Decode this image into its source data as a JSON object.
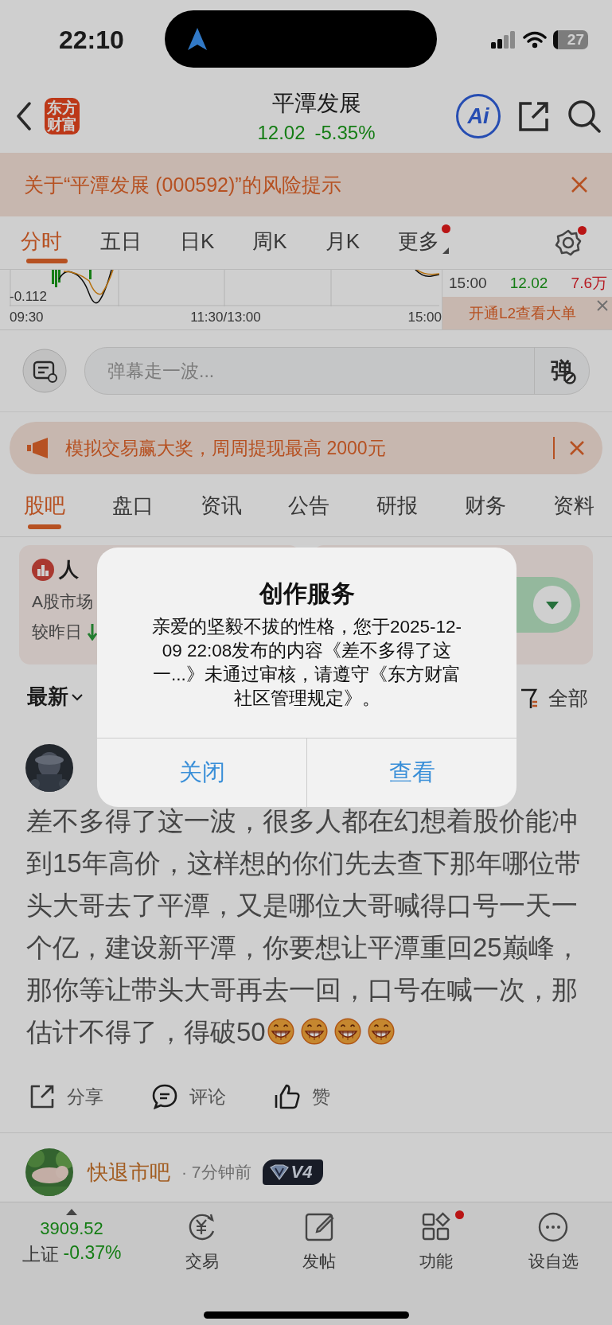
{
  "status_bar": {
    "time": "22:10",
    "battery": "27"
  },
  "header": {
    "logo": "东方财富",
    "title": "平潭发展",
    "price": "12.02",
    "change": "-5.35%",
    "ai_label": "Ai"
  },
  "risk_notice": {
    "text": "关于“平潭发展 (000592)”的风险提示"
  },
  "period_tabs": [
    {
      "label": "分时",
      "selected": true,
      "badge": false
    },
    {
      "label": "五日",
      "selected": false,
      "badge": false
    },
    {
      "label": "日K",
      "selected": false,
      "badge": false
    },
    {
      "label": "周K",
      "selected": false,
      "badge": false
    },
    {
      "label": "月K",
      "selected": false,
      "badge": false
    },
    {
      "label": "更多",
      "selected": false,
      "badge": true
    }
  ],
  "settings_badge": true,
  "chart": {
    "axis_value": "-0.112",
    "time_labels": [
      "09:30",
      "11:30/13:00",
      "15:00"
    ]
  },
  "trade_row": {
    "time": "15:00",
    "price": "12.02",
    "volume": "7.6万"
  },
  "l2_button": "开通L2查看大单",
  "danmaku": {
    "placeholder": "弹幕走一波...",
    "send_label": "弹"
  },
  "promo": {
    "text": "模拟交易赢大奖，周周提现最高 2000元"
  },
  "content_tabs": [
    {
      "label": "股吧",
      "selected": true
    },
    {
      "label": "盘口",
      "selected": false
    },
    {
      "label": "资讯",
      "selected": false
    },
    {
      "label": "公告",
      "selected": false
    },
    {
      "label": "研报",
      "selected": false
    },
    {
      "label": "财务",
      "selected": false
    },
    {
      "label": "资料",
      "selected": false
    }
  ],
  "popularity_card": {
    "title": "人",
    "line_1": "A股市场",
    "line_2": "较昨日"
  },
  "sort": {
    "label": "最新",
    "filter": "全部"
  },
  "post": {
    "text": "差不多得了这一波，很多人都在幻想着股价能冲到15年高价，这样想的你们先去查下那年哪位带头大哥去了平潭，又是哪位大哥喊得口号一天一个亿，建设新平潭，你要想让平潭重回25巅峰，那你等让带头大哥再去一回，口号在喊一次，那估计不得了，得破50",
    "emojis": [
      {
        "kind": "grin"
      },
      {
        "kind": "grin"
      },
      {
        "kind": "grin"
      },
      {
        "kind": "grin"
      }
    ],
    "actions": [
      {
        "kind": "share",
        "label": "分享"
      },
      {
        "kind": "comment",
        "label": "评论"
      },
      {
        "kind": "like",
        "label": "赞"
      }
    ]
  },
  "next_post": {
    "author": "快退市吧",
    "time": "· 7分钟前",
    "badge": "V4"
  },
  "bottom_nav": {
    "index": {
      "value": "3909.52",
      "name": "上证",
      "change": "-0.37%"
    },
    "items": [
      {
        "kind": "trade",
        "label": "交易",
        "badge": false
      },
      {
        "kind": "compose",
        "label": "发帖",
        "badge": false
      },
      {
        "kind": "functions",
        "label": "功能",
        "badge": true
      },
      {
        "kind": "more",
        "label": "设自选",
        "badge": false
      }
    ]
  },
  "dialog": {
    "title": "创作服务",
    "message": "亲爱的坚毅不拔的性格，您于2025-12-09 22:08发布的内容《差不多得了这一...》未通过审核，请遵守《东方财富社区管理规定》。",
    "buttons": [
      {
        "label": "关闭"
      },
      {
        "label": "查看"
      }
    ]
  }
}
